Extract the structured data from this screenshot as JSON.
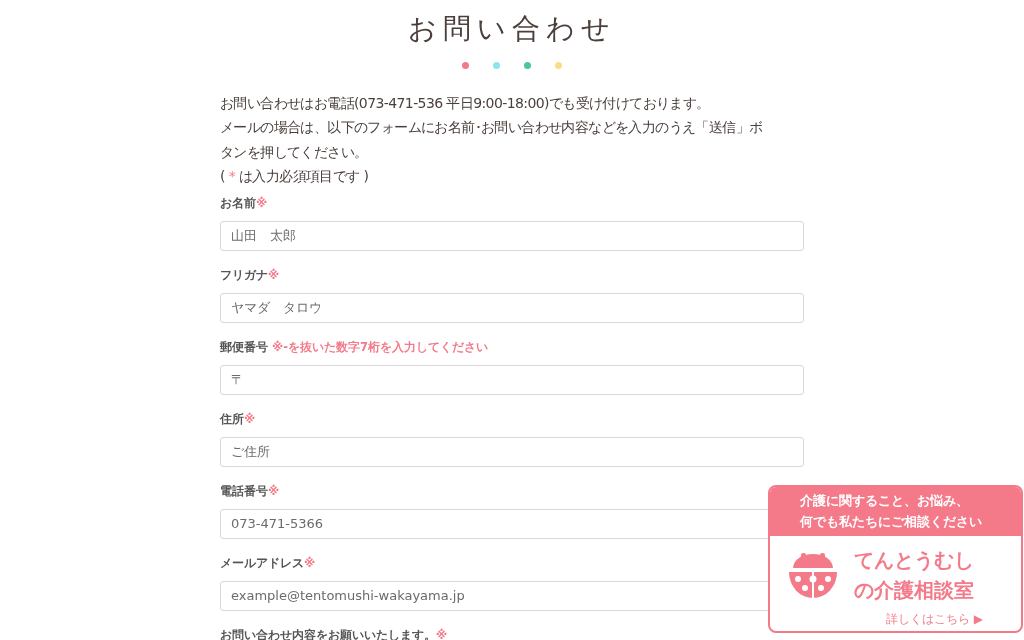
{
  "title": "お問い合わせ",
  "dots": [
    {
      "color": "#f47a8a"
    },
    {
      "color": "#8fe3f0"
    },
    {
      "color": "#4fc59a"
    },
    {
      "color": "#fddc86"
    }
  ],
  "intro": [
    "お問い合わせはお電話(073-471-536 平日9:00-18:00)でも受け付けております。",
    "メールの場合は、以下のフォームにお名前･お問い合わせ内容などを入力のうえ「送信」ボタンを押してください。"
  ],
  "required_note": {
    "before": "( ",
    "mark": "*",
    "after": " は入力必須項目です )"
  },
  "fields": [
    {
      "label": "お名前",
      "note": "※",
      "placeholder": "山田　太郎"
    },
    {
      "label": "フリガナ",
      "note": "※",
      "placeholder": "ヤマダ　タロウ"
    },
    {
      "label": "郵便番号",
      "note": " ※-を抜いた数字7桁を入力してください",
      "placeholder": "〒"
    },
    {
      "label": "住所",
      "note": "※",
      "placeholder": "ご住所"
    },
    {
      "label": "電話番号",
      "note": "※",
      "placeholder": "073-471-5366"
    },
    {
      "label": "メールアドレス",
      "note": "※",
      "placeholder": "example@tentomushi-wakayama.jp"
    },
    {
      "label": "お問い合わせ内容をお願いいたします。",
      "note": "※"
    }
  ],
  "banner": {
    "header_lines": [
      "介護に関すること、お悩み、",
      "何でも私たちにご相談ください"
    ],
    "name_lines": [
      "てんとうむし",
      "の介護相談室"
    ],
    "link": "詳しくはこちら ▶"
  }
}
